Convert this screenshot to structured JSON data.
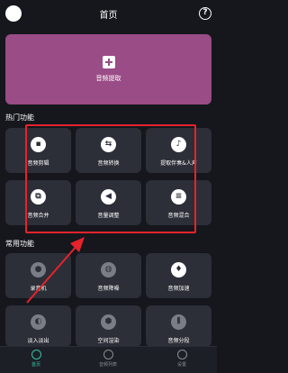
{
  "header": {
    "title": "首页",
    "help_label": "?"
  },
  "hero": {
    "label": "音频提取"
  },
  "hot": {
    "title": "热门功能",
    "items": [
      {
        "label": "音频剪辑",
        "icon": "▪"
      },
      {
        "label": "音频转换",
        "icon": "⇆"
      },
      {
        "label": "提取伴奏&人声",
        "icon": "♪"
      },
      {
        "label": "音频合并",
        "icon": "⧉"
      },
      {
        "label": "音量调整",
        "icon": "◀"
      },
      {
        "label": "音频混合",
        "icon": "≡"
      }
    ]
  },
  "common": {
    "title": "常用功能",
    "items": [
      {
        "label": "录音机",
        "icon": "●"
      },
      {
        "label": "音频降噪",
        "icon": "◍"
      },
      {
        "label": "音频加速",
        "icon": "♦"
      },
      {
        "label": "淡入淡出",
        "icon": "◐"
      },
      {
        "label": "空间渲染",
        "icon": "⬢"
      },
      {
        "label": "音频分段",
        "icon": "⫴"
      }
    ]
  },
  "tabs": [
    {
      "label": "首页"
    },
    {
      "label": "音频列表"
    },
    {
      "label": "设置"
    }
  ],
  "colors": {
    "accent": "#33c4a2",
    "hero": "#9a4c86",
    "highlight": "#e8222a"
  }
}
